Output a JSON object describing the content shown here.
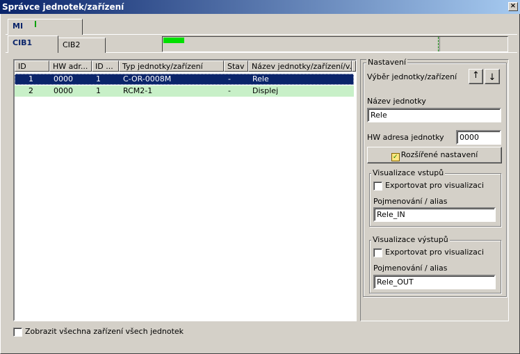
{
  "window": {
    "title": "Správce jednotek/zařízení",
    "close_glyph": "×"
  },
  "tabs_top": [
    {
      "label": "MI"
    }
  ],
  "tabs_sub": [
    {
      "label": "CIB1"
    },
    {
      "label": "CIB2"
    }
  ],
  "progress": {
    "fraction": 0.06
  },
  "table": {
    "columns": [
      "ID",
      "HW adr...",
      "ID ...",
      "Typ jednotky/zařízení",
      "Stav",
      "Název jednotky/zařízení/v..."
    ],
    "rows": [
      [
        "1",
        "0000",
        "1",
        "C-OR-0008M",
        "-",
        "Rele"
      ],
      [
        "2",
        "0000",
        "1",
        "RCM2-1",
        "-",
        "Displej"
      ]
    ]
  },
  "show_all": {
    "label": "Zobrazit všechna zařízení všech jednotek",
    "checked": false
  },
  "settings": {
    "title": "Nastavení",
    "selector_label": "Výběr jednotky/zařízení",
    "up_glyph": "↑",
    "down_glyph": "↓",
    "unit_name_label": "Název jednotky",
    "unit_name_value": "Rele",
    "hw_address_label": "HW adresa jednotky",
    "hw_address_value": "0000",
    "advanced_button": "Rozšířené nastavení",
    "inputs_group": {
      "title": "Visualizace vstupů",
      "export_label": "Exportovat pro visualizaci",
      "alias_label": "Pojmenování / alias",
      "alias_value": "Rele_IN"
    },
    "outputs_group": {
      "title": "Visualizace výstupů",
      "export_label": "Exportovat pro visualizaci",
      "alias_label": "Pojmenování / alias",
      "alias_value": "Rele_OUT"
    }
  }
}
